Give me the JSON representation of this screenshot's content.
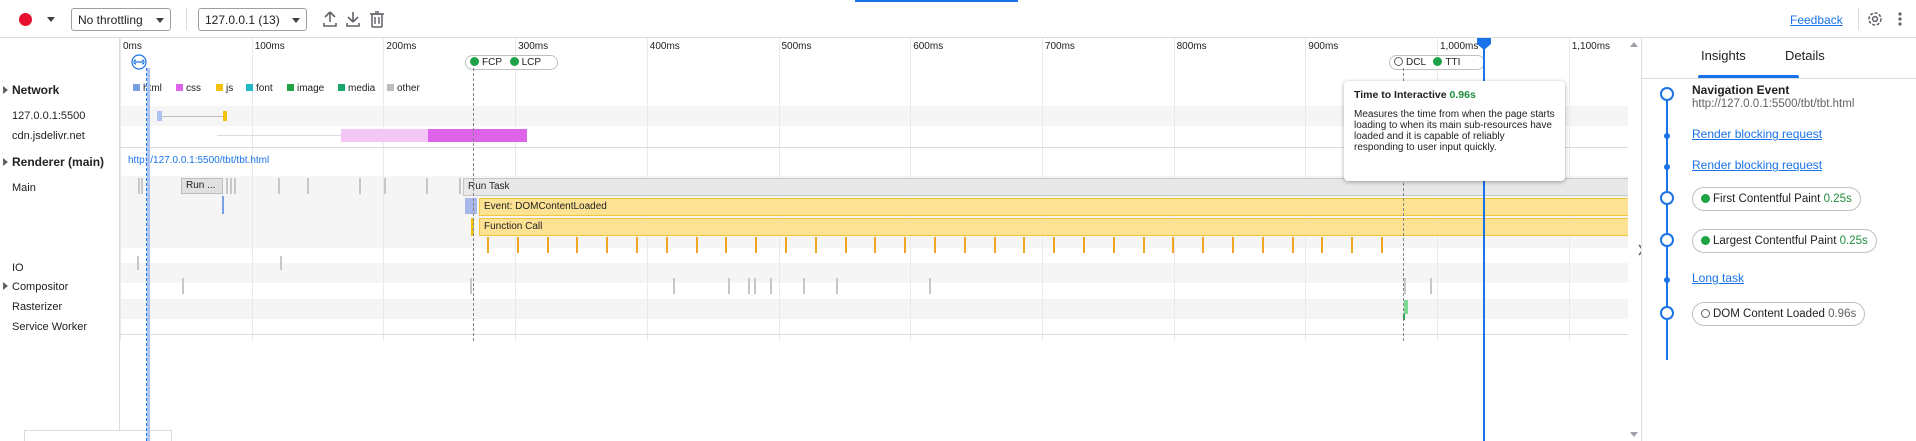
{
  "toolbar": {
    "throttling": "No throttling",
    "target": "127.0.0.1 (13)",
    "feedback": "Feedback",
    "upload_icon": "upload-icon",
    "download_icon": "download-icon",
    "trash_icon": "trash-icon",
    "settings_icon": "gear-icon",
    "more_icon": "more-vert-icon"
  },
  "ruler": {
    "ticks": [
      "0ms",
      "100ms",
      "200ms",
      "300ms",
      "400ms",
      "500ms",
      "600ms",
      "700ms",
      "800ms",
      "900ms",
      "1,000ms",
      "1,100ms"
    ]
  },
  "markers": {
    "fcp": "FCP",
    "lcp": "LCP",
    "dcl": "DCL",
    "tti": "TTI"
  },
  "network": {
    "title": "Network",
    "legend": [
      "html",
      "css",
      "js",
      "font",
      "image",
      "media",
      "other"
    ],
    "legend_colors": [
      "#7b9fe3",
      "#dd63e8",
      "#f4c20d",
      "#21b8c7",
      "#1ea446",
      "#18a66e",
      "#bdbdbd"
    ],
    "rows": [
      "127.0.0.1:5500",
      "cdn.jsdelivr.net"
    ]
  },
  "renderer": {
    "title": "Renderer (main)",
    "url": "http://127.0.0.1:5500/tbt/tbt.html",
    "main_label": "Main",
    "run_short": "Run ...",
    "run_task": "Run Task",
    "dom_event": "Event: DOMContentLoaded",
    "function_call": "Function Call",
    "io": "IO",
    "compositor": "Compositor",
    "rasterizer": "Rasterizer",
    "service_worker": "Service Worker"
  },
  "tooltip": {
    "title": "Time to Interactive",
    "value": "0.96s",
    "body": "Measures the time from when the page starts loading to when its main sub-resources have loaded and it is capable of reliably responding to user input quickly."
  },
  "insights": {
    "tabs": [
      "Insights",
      "Details"
    ],
    "nav_title": "Navigation Event",
    "nav_url": "http://127.0.0.1:5500/tbt/tbt.html",
    "render_blocking_1": "Render blocking request",
    "render_blocking_2": "Render blocking request",
    "fcp_label": "First Contentful Paint",
    "fcp_value": "0.25s",
    "lcp_label": "Largest Contentful Paint",
    "lcp_value": "0.25s",
    "long_task": "Long task",
    "dcl_label": "DOM Content Loaded",
    "dcl_value": "0.96s"
  },
  "colors": {
    "accent": "#1a73e8",
    "run_task": "#e8e8e8",
    "event": "#fde293",
    "event_border": "#f2c53d",
    "css_light": "#f2c6f5",
    "css": "#dd63e8",
    "js": "#f4c20d",
    "html": "#7b9fe3"
  }
}
